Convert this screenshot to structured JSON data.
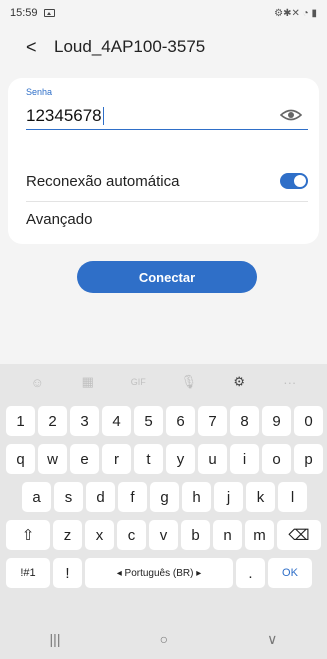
{
  "status_bar": {
    "time": "15:59",
    "right_icons": "⚙✱✕ ◔ ▮"
  },
  "header": {
    "back_icon": "back-icon",
    "title": "Loud_4AP100-3575"
  },
  "password": {
    "label": "Senha",
    "value": "12345678"
  },
  "settings": {
    "auto_reconnect_label": "Reconexão automática",
    "auto_reconnect_on": true,
    "advanced_label": "Avançado"
  },
  "connect_button": {
    "label": "Conectar"
  },
  "keyboard": {
    "toolbar": [
      "☺",
      "▦",
      "GIF",
      "🎙",
      "⚙",
      "···"
    ],
    "rows": [
      [
        "1",
        "2",
        "3",
        "4",
        "5",
        "6",
        "7",
        "8",
        "9",
        "0"
      ],
      [
        "q",
        "w",
        "e",
        "r",
        "t",
        "y",
        "u",
        "i",
        "o",
        "p"
      ],
      [
        "a",
        "s",
        "d",
        "f",
        "g",
        "h",
        "j",
        "k",
        "l"
      ],
      [
        "⇧",
        "z",
        "x",
        "c",
        "v",
        "b",
        "n",
        "m",
        "⌫"
      ],
      [
        "!#1",
        "!",
        "◂ Português (BR) ▸",
        ".",
        "OK"
      ]
    ]
  },
  "nav_bar": {
    "recent": "|||",
    "home": "○",
    "back": "∨"
  },
  "colors": {
    "accent": "#2f6fc8",
    "background": "#f4f4f4",
    "card": "#ffffff"
  }
}
